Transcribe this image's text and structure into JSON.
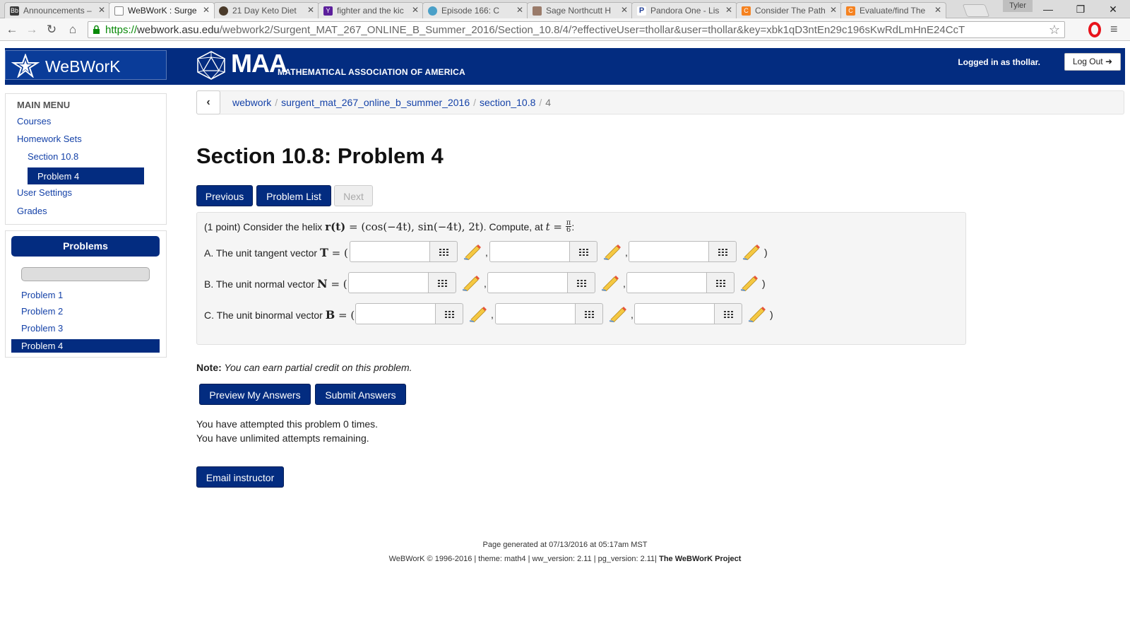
{
  "browser": {
    "tabs": [
      {
        "title": "Announcements –",
        "fav_text": "Bb",
        "fav_color": "#3b3b3b"
      },
      {
        "title": "WeBWorK : Surge",
        "fav_text": "",
        "fav_color": "#ffffff"
      },
      {
        "title": "21 Day Keto Diet",
        "fav_text": "",
        "fav_color": "#4a3a2a"
      },
      {
        "title": "fighter and the kic",
        "fav_text": "Y",
        "fav_color": "#5c1f9c"
      },
      {
        "title": "Episode 166: C",
        "fav_text": "",
        "fav_color": "#4aa0c8"
      },
      {
        "title": "Sage Northcutt H",
        "fav_text": "",
        "fav_color": "#9a7b6a"
      },
      {
        "title": "Pandora One - Lis",
        "fav_text": "P",
        "fav_color": "#ffffff"
      },
      {
        "title": "Consider The Path",
        "fav_text": "C",
        "fav_color": "#f58220"
      },
      {
        "title": "Evaluate/find The",
        "fav_text": "C",
        "fav_color": "#f58220"
      }
    ],
    "profile_name": "Tyler",
    "url_scheme": "https://",
    "url_host": "webwork.asu.edu",
    "url_path": "/webwork2/Surgent_MAT_267_ONLINE_B_Summer_2016/Section_10.8/4/?effectiveUser=thollar&user=thollar&key=xbk1qD3ntEn29c196sKwRdLmHnE24CcT"
  },
  "header": {
    "app_name": "WeBWorK",
    "maa_big": "MAA",
    "maa_sub": "MATHEMATICAL ASSOCIATION OF AMERICA",
    "logged_in_text": "Logged in as thollar.",
    "logout_label": "Log Out"
  },
  "sidebar": {
    "main_menu_title": "MAIN MENU",
    "courses": "Courses",
    "homework_sets": "Homework Sets",
    "section": "Section 10.8",
    "problem_active": "Problem 4",
    "user_settings": "User Settings",
    "grades": "Grades",
    "problems_title": "Problems",
    "problem_items": [
      "Problem 1",
      "Problem 2",
      "Problem 3",
      "Problem 4"
    ]
  },
  "breadcrumb": {
    "items": [
      "webwork",
      "surgent_mat_267_online_b_summer_2016",
      "section_10.8"
    ],
    "current": "4"
  },
  "page": {
    "title": "Section 10.8: Problem 4",
    "previous_label": "Previous",
    "problem_list_label": "Problem List",
    "next_label": "Next"
  },
  "problem": {
    "intro_prefix": "(1 point) Consider the helix ",
    "helix_lhs": "r(t)",
    "helix_rhs": " = (cos(−4t), sin(−4t), 2t)",
    "intro_mid": ". Compute, at ",
    "t_var": "t",
    "t_eq": " = ",
    "t_num": "π",
    "t_den": "6",
    "intro_suffix": ":",
    "questions": [
      {
        "prefix": "A. The unit tangent vector ",
        "symbol": "T",
        "eq": " = (",
        "answers": [
          "",
          "",
          ""
        ]
      },
      {
        "prefix": "B. The unit normal vector ",
        "symbol": "N",
        "eq": " = (",
        "answers": [
          "",
          "",
          ""
        ]
      },
      {
        "prefix": "C. The unit binormal vector ",
        "symbol": "B",
        "eq": " = (",
        "answers": [
          "",
          "",
          ""
        ]
      }
    ],
    "comma": ",",
    "close_paren": ")"
  },
  "note": {
    "label": "Note:",
    "text": " You can earn partial credit on this problem."
  },
  "actions": {
    "preview_label": "Preview My Answers",
    "submit_label": "Submit Answers",
    "email_label": "Email instructor"
  },
  "status": {
    "attempted": "You have attempted this problem 0 times.",
    "remaining": "You have unlimited attempts remaining."
  },
  "footer": {
    "generated": "Page generated at 07/13/2016 at 05:17am MST",
    "copyright": "WeBWorK © 1996-2016 | theme: math4 | ww_version: 2.11 | pg_version: 2.11|",
    "project": " The WeBWorK Project"
  },
  "colors": {
    "brand_navy": "#032c80",
    "link_blue": "#1542a8"
  }
}
